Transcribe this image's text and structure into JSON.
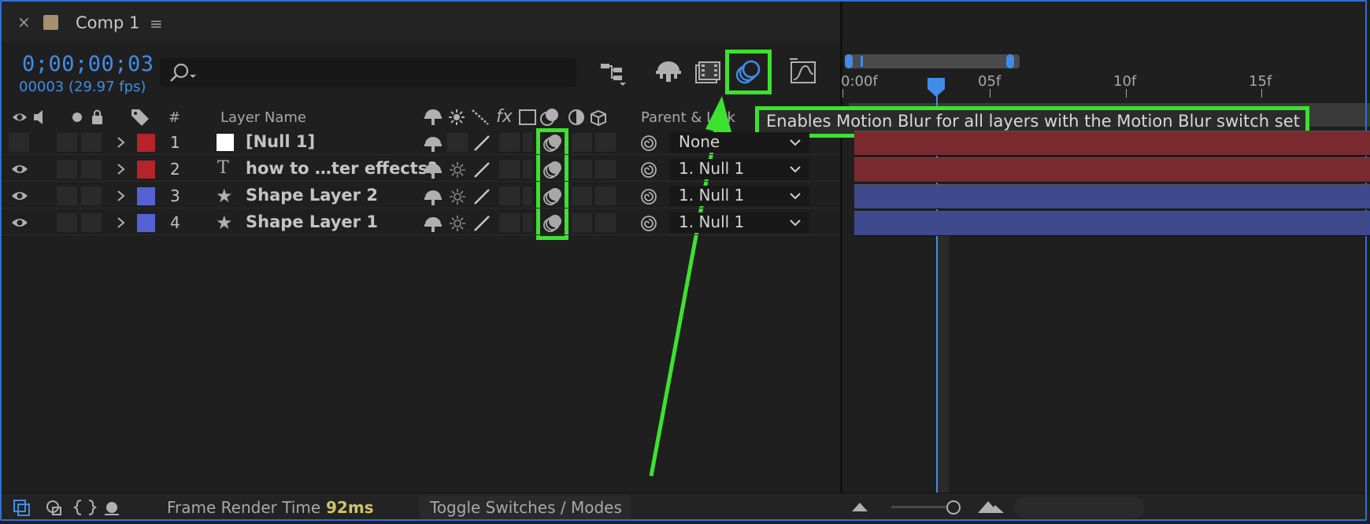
{
  "app": {
    "close_glyph": "×",
    "comp_title": "Comp 1",
    "menu_glyph": "≡",
    "swatch_color": "#a68f6e"
  },
  "time": {
    "timecode": "0;00;00;03",
    "frame_fps": "00003 (29.97 fps)"
  },
  "search": {
    "placeholder": ""
  },
  "toolbar": {
    "icons": [
      "composition-flowchart-icon",
      "draft-3d-icon",
      "frame-blending-icon",
      "motion-blur-icon",
      "graph-editor-icon"
    ],
    "motion_blur_active": true
  },
  "columns": {
    "number": "#",
    "layer_name": "Layer Name",
    "fx": "fx",
    "parent_link": "Parent & Link"
  },
  "layers": [
    {
      "number": "1",
      "name": "[Null 1]",
      "type": "null",
      "label_color": "#b5232b",
      "visible": false,
      "parent": "None"
    },
    {
      "number": "2",
      "name": "how to …ter effects?",
      "type": "text",
      "type_glyph": "T",
      "label_color": "#b5232b",
      "visible": true,
      "parent": "1. Null 1"
    },
    {
      "number": "3",
      "name": "Shape Layer 2",
      "type": "shape",
      "type_glyph": "★",
      "label_color": "#5462d6",
      "visible": true,
      "parent": "1. Null 1"
    },
    {
      "number": "4",
      "name": "Shape Layer 1",
      "type": "shape",
      "type_glyph": "★",
      "label_color": "#5462d6",
      "visible": true,
      "parent": "1. Null 1"
    }
  ],
  "timeline": {
    "ruler": [
      "0:00f",
      "05f",
      "10f",
      "15f"
    ],
    "current_frame": 3,
    "bar_colors": [
      "#7a2a2f",
      "#7a2a2f",
      "#3e4a8c",
      "#3e4a8c"
    ]
  },
  "tooltip": {
    "text": "Enables Motion Blur for all layers with the Motion Blur switch set"
  },
  "status": {
    "frame_render_label": "Frame Render Time",
    "frame_render_value": "92ms",
    "toggle_label": "Toggle Switches / Modes"
  },
  "colors": {
    "accent": "#3f8de8",
    "highlight": "#3de22e"
  }
}
